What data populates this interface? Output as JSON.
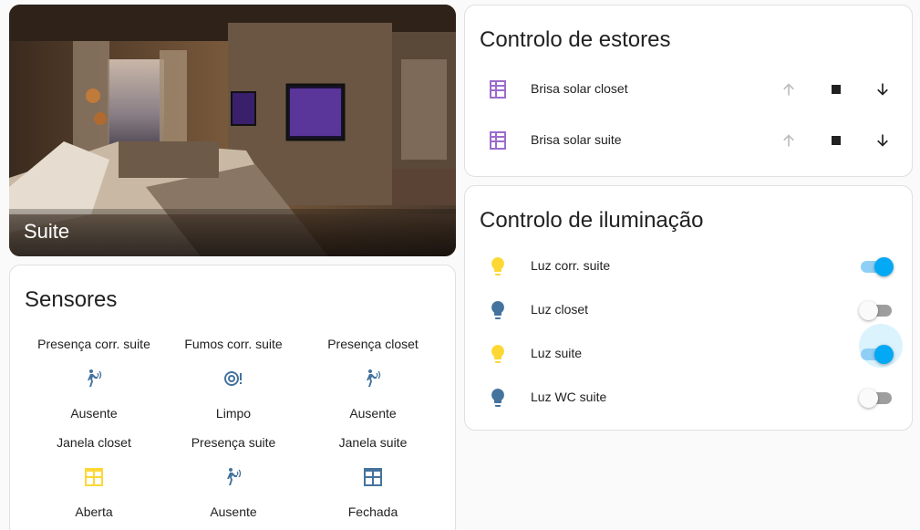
{
  "picture_card": {
    "title": "Suite"
  },
  "sensors": {
    "title": "Sensores",
    "items": [
      {
        "name": "Presença corr. suite",
        "state": "Ausente",
        "icon": "motion-sensor-icon",
        "color": "#44739e"
      },
      {
        "name": "Fumos corr. suite",
        "state": "Limpo",
        "icon": "smoke-detector-icon",
        "color": "#44739e"
      },
      {
        "name": "Presença closet",
        "state": "Ausente",
        "icon": "motion-sensor-icon",
        "color": "#44739e"
      },
      {
        "name": "Janela closet",
        "state": "Aberta",
        "icon": "window-open-icon",
        "color": "#fdd835"
      },
      {
        "name": "Presença suite",
        "state": "Ausente",
        "icon": "motion-sensor-icon",
        "color": "#44739e"
      },
      {
        "name": "Janela suite",
        "state": "Fechada",
        "icon": "window-closed-icon",
        "color": "#44739e"
      }
    ]
  },
  "shades": {
    "title": "Controlo de estores",
    "items": [
      {
        "name": "Brisa solar closet",
        "icon": "blinds-icon"
      },
      {
        "name": "Brisa solar suite",
        "icon": "blinds-icon"
      }
    ]
  },
  "lights": {
    "title": "Controlo de iluminação",
    "items": [
      {
        "name": "Luz corr. suite",
        "on": true
      },
      {
        "name": "Luz closet",
        "on": false
      },
      {
        "name": "Luz suite",
        "on": true
      },
      {
        "name": "Luz WC suite",
        "on": false
      }
    ]
  },
  "colors": {
    "accent": "#03a9f4",
    "light_on": "#fdd835",
    "light_off": "#44739e",
    "blinds_icon": "#9c6ccd"
  }
}
